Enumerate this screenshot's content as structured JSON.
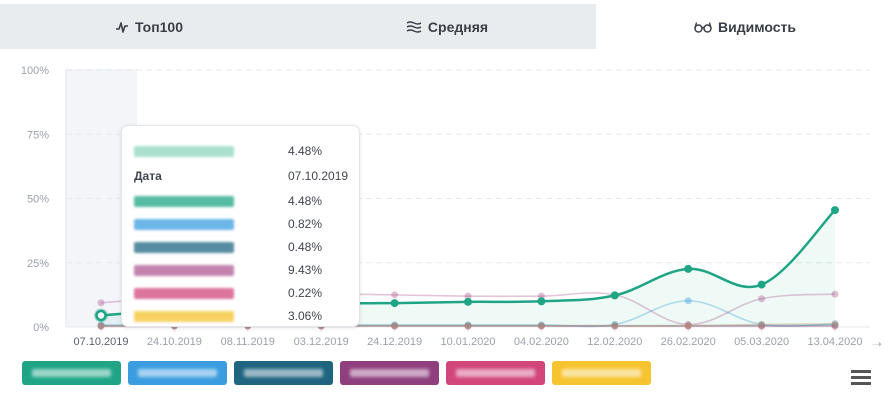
{
  "tabs": [
    {
      "label": "Топ100",
      "icon": "activity-icon",
      "active": false
    },
    {
      "label": "Средняя",
      "icon": "wave-lines-icon",
      "active": false
    },
    {
      "label": "Видимость",
      "icon": "glasses-icon",
      "active": true
    }
  ],
  "tooltip": {
    "header_value": "4.48%",
    "date_label": "Дата",
    "date_value": "07.10.2019",
    "rows": [
      {
        "color": "#1fa586",
        "value": "4.48%"
      },
      {
        "color": "#3b9de0",
        "value": "0.82%"
      },
      {
        "color": "#1f6580",
        "value": "0.48%"
      },
      {
        "color": "#b05a92",
        "value": "9.43%"
      },
      {
        "color": "#d2467c",
        "value": "0.22%"
      },
      {
        "color": "#f7c431",
        "value": "3.06%"
      }
    ]
  },
  "legend": [
    {
      "color": "#1fa586"
    },
    {
      "color": "#3b9de0"
    },
    {
      "color": "#1f6580"
    },
    {
      "color": "#8f3f7e"
    },
    {
      "color": "#d2467c"
    },
    {
      "color": "#f7c431"
    }
  ],
  "chart_data": {
    "type": "line",
    "categories": [
      "07.10.2019",
      "24.10.2019",
      "08.11.2019",
      "03.12.2019",
      "24.12.2019",
      "10.01.2020",
      "04.02.2020",
      "12.02.2020",
      "26.02.2020",
      "05.03.2020",
      "13.04.2020"
    ],
    "yticks": [
      "0%",
      "25%",
      "50%",
      "75%",
      "100%"
    ],
    "ylim": [
      0,
      100
    ],
    "grid": true,
    "highlighted_index": 0,
    "series": [
      {
        "color": "#1fa586",
        "area": true,
        "values": [
          4.48,
          6.8,
          8.5,
          9.2,
          9.3,
          9.8,
          10.0,
          12.3,
          22.6,
          16.5,
          45.5
        ]
      },
      {
        "color": "#3b9de0",
        "values": [
          0.82,
          0.8,
          0.8,
          0.8,
          0.8,
          0.8,
          0.8,
          1.0,
          10.2,
          1.0,
          1.2
        ]
      },
      {
        "color": "#1f6580",
        "values": [
          0.48,
          0.5,
          0.5,
          0.5,
          0.5,
          0.5,
          0.5,
          0.5,
          0.5,
          0.6,
          0.7
        ]
      },
      {
        "color": "#b05a92",
        "values": [
          9.43,
          11.5,
          12.5,
          12.8,
          12.5,
          12.0,
          12.0,
          12.5,
          1.0,
          11.0,
          12.8
        ]
      },
      {
        "color": "#d2467c",
        "values": [
          0.22,
          0.3,
          0.3,
          0.3,
          0.3,
          0.3,
          0.3,
          0.3,
          0.3,
          0.3,
          0.3
        ]
      },
      {
        "color": "#c9a070",
        "values": [
          0.4,
          0.5,
          0.5,
          0.5,
          0.5,
          0.5,
          0.5,
          0.5,
          0.5,
          1.0,
          1.3
        ]
      }
    ]
  }
}
